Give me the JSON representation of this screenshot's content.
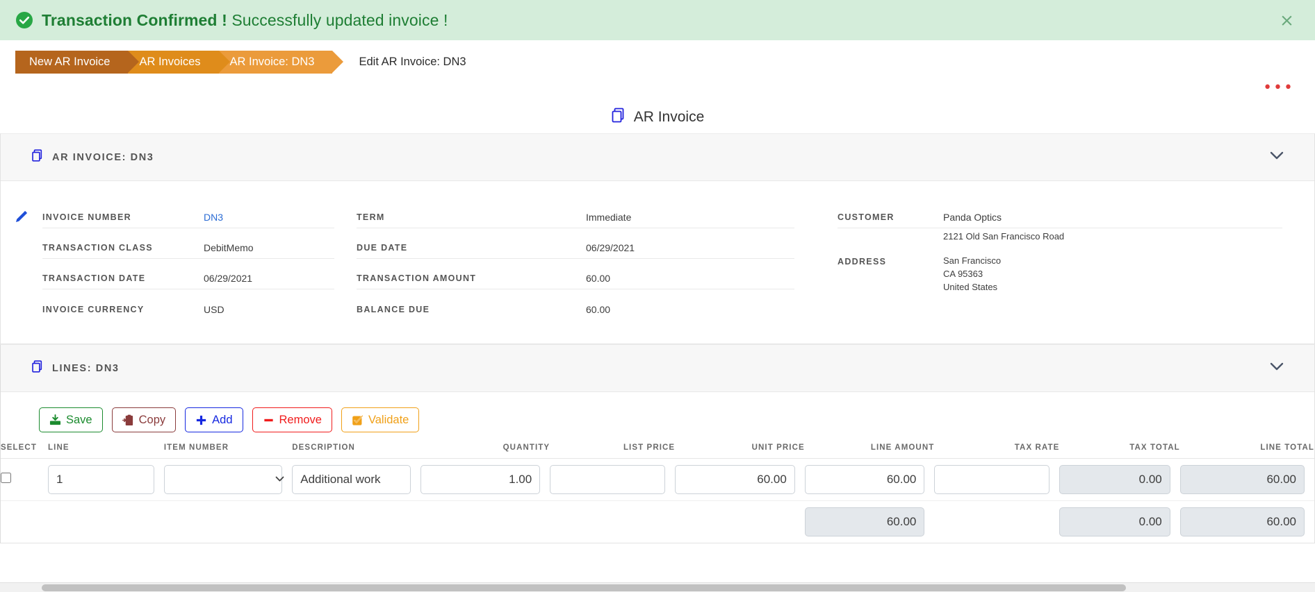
{
  "alert": {
    "icon": "check-circle-icon",
    "bold_text": "Transaction Confirmed !",
    "rest_text": " Successfully updated invoice !",
    "close_label": "×",
    "bg_color": "#d4edda",
    "text_color": "#1e7e34"
  },
  "breadcrumb": {
    "items": [
      {
        "label": "New AR Invoice",
        "color": "#b5651d"
      },
      {
        "label": "AR Invoices",
        "color": "#df8c1b"
      },
      {
        "label": "AR Invoice: DN3",
        "color": "#eb9b3b"
      }
    ],
    "current": "Edit AR Invoice: DN3"
  },
  "overflow_menu": {
    "label": "•••",
    "color": "#e03b3b"
  },
  "page_title": {
    "icon": "copy-documents-icon",
    "text": "AR Invoice"
  },
  "invoice_card": {
    "icon": "copy-documents-icon",
    "title": "AR INVOICE: DN3",
    "collapse_icon": "chevron-down-icon",
    "edit_icon": "pencil-icon",
    "column1": [
      {
        "label": "INVOICE NUMBER",
        "value": "DN3",
        "is_link": true
      },
      {
        "label": "TRANSACTION CLASS",
        "value": "DebitMemo",
        "is_link": false
      },
      {
        "label": "TRANSACTION DATE",
        "value": "06/29/2021",
        "is_link": false
      },
      {
        "label": "INVOICE CURRENCY",
        "value": "USD",
        "is_link": false
      }
    ],
    "column2": [
      {
        "label": "TERM",
        "value": "Immediate"
      },
      {
        "label": "DUE DATE",
        "value": "06/29/2021"
      },
      {
        "label": "TRANSACTION AMOUNT",
        "value": "60.00"
      },
      {
        "label": "BALANCE DUE",
        "value": "60.00"
      }
    ],
    "customer": {
      "label": "CUSTOMER",
      "value": "Panda Optics"
    },
    "address": {
      "label": "ADDRESS",
      "street": "2121 Old San Francisco Road",
      "city": "San Francisco",
      "region": "CA 95363",
      "country": "United States"
    }
  },
  "lines_card": {
    "icon": "copy-documents-icon",
    "title": "LINES: DN3",
    "collapse_icon": "chevron-down-icon",
    "toolbar": [
      {
        "label": "Save",
        "icon": "save-icon",
        "color": "#1b8b2e"
      },
      {
        "label": "Copy",
        "icon": "clipboard-paste-icon",
        "color": "#8a3b3b"
      },
      {
        "label": "Add",
        "icon": "plus-icon",
        "color": "#1528e0"
      },
      {
        "label": "Remove",
        "icon": "minus-icon",
        "color": "#f01b1b"
      },
      {
        "label": "Validate",
        "icon": "check-square-icon",
        "color": "#f0a018"
      }
    ],
    "columns": [
      "SELECT",
      "LINE",
      "ITEM NUMBER",
      "DESCRIPTION",
      "QUANTITY",
      "LIST PRICE",
      "UNIT PRICE",
      "LINE AMOUNT",
      "TAX RATE",
      "TAX TOTAL",
      "LINE TOTAL"
    ],
    "row": {
      "selected": false,
      "line": "1",
      "item_number": "",
      "item_number_placeholder": "",
      "description": "Additional work",
      "quantity": "1.00",
      "list_price": "",
      "unit_price": "60.00",
      "line_amount": "60.00",
      "tax_rate": "",
      "tax_total": "0.00",
      "line_total": "60.00"
    },
    "totals": {
      "line_amount": "60.00",
      "tax_total": "0.00",
      "line_total": "60.00"
    }
  }
}
